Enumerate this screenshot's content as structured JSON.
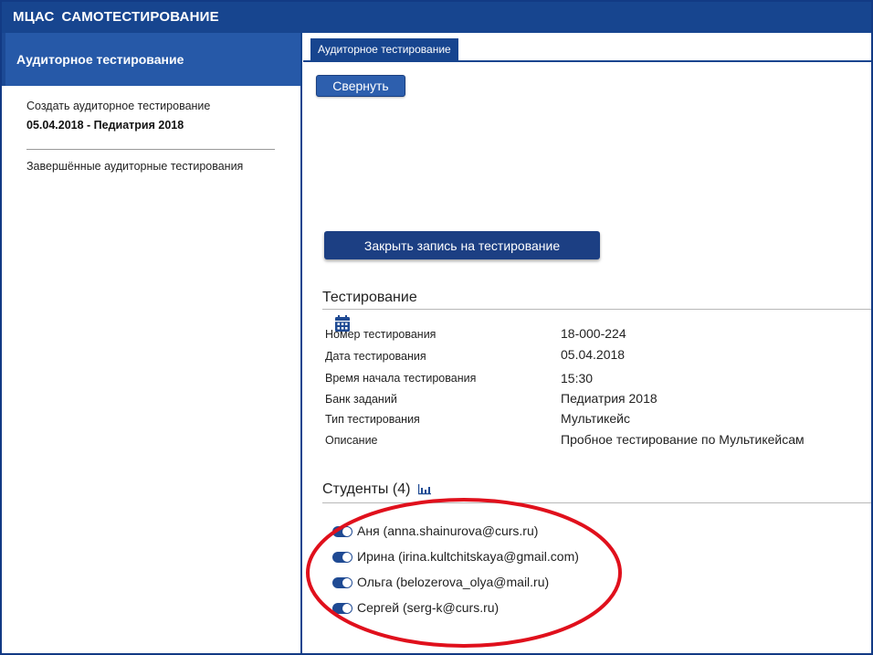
{
  "app": {
    "title_part1": "МЦАС",
    "title_part2": "САМОТЕСТИРОВАНИЕ"
  },
  "sidebar": {
    "header": "Аудиторное тестирование",
    "create_link": "Создать аудиторное тестирование",
    "current_test": "05.04.2018 - Педиатрия 2018",
    "completed_link": "Завершённые аудиторные тестирования"
  },
  "main": {
    "tab_label": "Аудиторное тестирование",
    "collapse_button": "Свернуть",
    "close_registration_button": "Закрыть запись на тестирование",
    "testing_section": {
      "title": "Тестирование",
      "rows": [
        {
          "label": "Номер тестирования",
          "value": "18-000-224"
        },
        {
          "label": "Дата тестирования",
          "value": "05.04.2018"
        },
        {
          "label": "Время начала тестирования",
          "value": "15:30"
        },
        {
          "label": "Банк заданий",
          "value": "Педиатрия 2018"
        },
        {
          "label": "Тип тестирования",
          "value": "Мультикейс"
        },
        {
          "label": "Описание",
          "value": "Пробное тестирование по Мультикейсам"
        }
      ]
    },
    "students_section": {
      "title": "Студенты (4)",
      "students": [
        {
          "text": "Аня (anna.shainurova@curs.ru)",
          "enabled": true
        },
        {
          "text": "Ирина (irina.kultchitskaya@gmail.com)",
          "enabled": true
        },
        {
          "text": "Ольга (belozerova_olya@mail.ru)",
          "enabled": true
        },
        {
          "text": "Сергей (serg-k@curs.ru)",
          "enabled": true
        }
      ]
    }
  },
  "colors": {
    "brand_blue": "#17458f",
    "sidebar_header": "#2659a8",
    "button_dark": "#1c3f83",
    "annotation_red": "#e0101c"
  },
  "icons": {
    "date_picker": "calendar-icon",
    "students_chart": "bar-chart-icon"
  }
}
